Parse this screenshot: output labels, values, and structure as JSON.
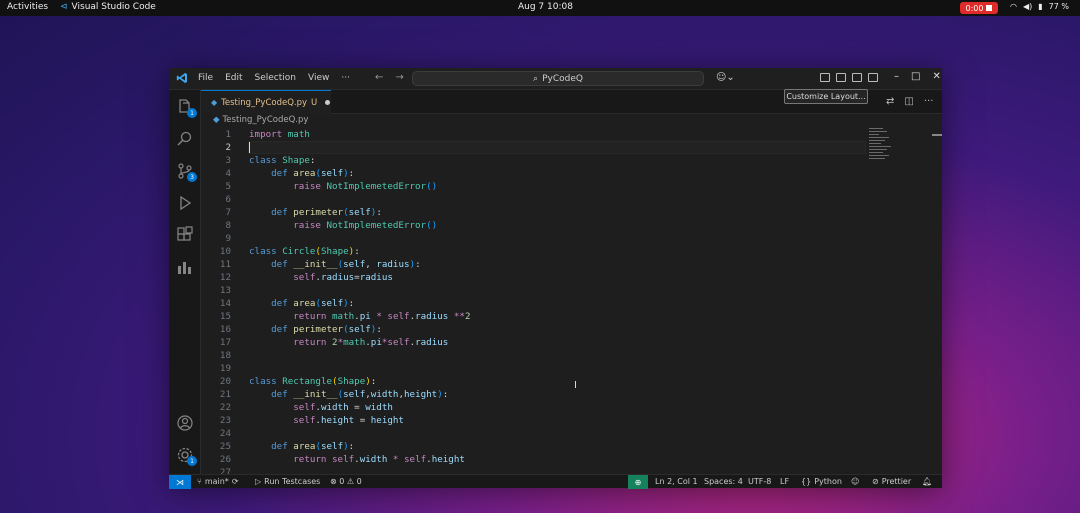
{
  "system_bar": {
    "activities": "Activities",
    "app_name": "Visual Studio Code",
    "clock": "Aug 7  10:08",
    "recording": "0:00",
    "battery": "77 %"
  },
  "title_bar": {
    "menu": [
      "File",
      "Edit",
      "Selection",
      "View",
      "···"
    ],
    "command_center": "PyCodeQ",
    "tooltip": "Customize Layout..."
  },
  "activity_bar": {
    "explorer_badge": "1",
    "scm_badge": "3",
    "settings_badge": "1"
  },
  "tab": {
    "filename": "Testing_PyCodeQ.py",
    "status": "U"
  },
  "breadcrumb": {
    "file": "Testing_PyCodeQ.py"
  },
  "editor": {
    "current_line": 2,
    "lines": [
      {
        "n": "1",
        "html": "<span class='kw'>import</span> <span class='mod'>math</span>"
      },
      {
        "n": "2",
        "html": ""
      },
      {
        "n": "3",
        "html": "<span class='kd'>class</span> <span class='cls'>Shape</span>:"
      },
      {
        "n": "4",
        "html": "    <span class='kd'>def</span> <span class='fn'>area</span><span class='par'>(</span><span class='plain'>self</span><span class='par'>)</span>:"
      },
      {
        "n": "5",
        "html": "        <span class='kw'>raise</span> <span class='cls'>NotImplemetedError</span><span class='par'>()</span>"
      },
      {
        "n": "6",
        "html": ""
      },
      {
        "n": "7",
        "html": "    <span class='kd'>def</span> <span class='fn'>perimeter</span><span class='par'>(</span><span class='plain'>self</span><span class='par'>)</span>:"
      },
      {
        "n": "8",
        "html": "        <span class='kw'>raise</span> <span class='cls'>NotImplemetedError</span><span class='par'>()</span>"
      },
      {
        "n": "9",
        "html": ""
      },
      {
        "n": "10",
        "html": "<span class='kd'>class</span> <span class='cls'>Circle</span><span class='gold'>(</span><span class='cls'>Shape</span><span class='gold'>)</span>:"
      },
      {
        "n": "11",
        "html": "    <span class='kd'>def</span> <span class='fn'>__init__</span><span class='par'>(</span><span class='plain'>self</span>, <span class='plain'>radius</span><span class='par'>)</span>:"
      },
      {
        "n": "12",
        "html": "        <span class='kw'>self</span>.<span class='plain'>radius</span>=<span class='plain'>radius</span>"
      },
      {
        "n": "13",
        "html": ""
      },
      {
        "n": "14",
        "html": "    <span class='kd'>def</span> <span class='fn'>area</span><span class='par'>(</span><span class='plain'>self</span><span class='par'>)</span>:"
      },
      {
        "n": "15",
        "html": "        <span class='kw'>return</span> <span class='mod'>math</span>.<span class='plain'>pi</span> <span class='kw'>*</span> <span class='kw'>self</span>.<span class='plain'>radius</span> <span class='kw'>**</span><span class='num'>2</span>"
      },
      {
        "n": "16",
        "html": "    <span class='kd'>def</span> <span class='fn'>perimeter</span><span class='par'>(</span><span class='plain'>self</span><span class='par'>)</span>:"
      },
      {
        "n": "17",
        "html": "        <span class='kw'>return</span> <span class='num'>2</span><span class='kw'>*</span><span class='mod'>math</span>.<span class='plain'>pi</span><span class='kw'>*</span><span class='kw'>self</span>.<span class='plain'>radius</span>"
      },
      {
        "n": "18",
        "html": ""
      },
      {
        "n": "19",
        "html": ""
      },
      {
        "n": "20",
        "html": "<span class='kd'>class</span> <span class='cls'>Rectangle</span><span class='gold'>(</span><span class='cls'>Shape</span><span class='gold'>)</span>:"
      },
      {
        "n": "21",
        "html": "    <span class='kd'>def</span> <span class='fn'>__init__</span><span class='par'>(</span><span class='plain'>self</span>,<span class='plain'>width</span>,<span class='plain'>height</span><span class='par'>)</span>:"
      },
      {
        "n": "22",
        "html": "        <span class='kw'>self</span>.<span class='plain'>width</span> = <span class='plain'>width</span>"
      },
      {
        "n": "23",
        "html": "        <span class='kw'>self</span>.<span class='plain'>height</span> = <span class='plain'>height</span>"
      },
      {
        "n": "24",
        "html": ""
      },
      {
        "n": "25",
        "html": "    <span class='kd'>def</span> <span class='fn'>area</span><span class='par'>(</span><span class='plain'>self</span><span class='par'>)</span>:"
      },
      {
        "n": "26",
        "html": "        <span class='kw'>return</span> <span class='kw'>self</span>.<span class='plain'>width</span> <span class='kw'>*</span> <span class='kw'>self</span>.<span class='plain'>height</span>"
      },
      {
        "n": "27",
        "html": ""
      }
    ]
  },
  "status_bar": {
    "branch": "main*",
    "run_testcases": "Run Testcases",
    "problems": "⊗ 0 ⚠ 0",
    "position": "Ln 2, Col 1",
    "spaces": "Spaces: 4",
    "encoding": "UTF-8",
    "eol": "LF",
    "language": "Python",
    "prettier": "Prettier"
  }
}
